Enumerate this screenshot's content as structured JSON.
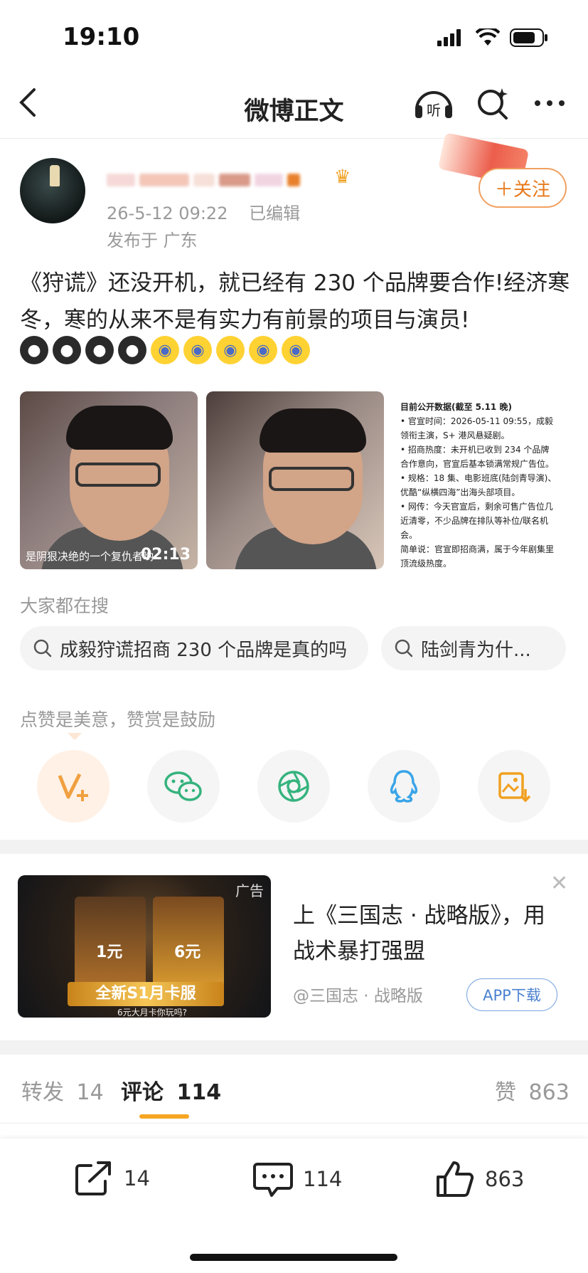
{
  "status_bar": {
    "time": "19:10"
  },
  "nav": {
    "title": "微博正文",
    "listen_label": "听"
  },
  "post": {
    "timestamp": "26-5-12 09:22",
    "edited_label": "已编辑",
    "location": "发布于 广东",
    "follow_label": "＋关注",
    "text": "《狩谎》还没开机，就已经有 230 个品牌要合作!经济寒冬，寒的从来不是有实力有前景的项目与演员!",
    "emojis": [
      "cry",
      "cry",
      "cry",
      "cry",
      "fear",
      "fear",
      "fear",
      "fear",
      "fear"
    ],
    "video": {
      "caption": "是阴狠决绝的一个复仇者哟",
      "duration": "02:13"
    },
    "doc_image": {
      "heading": "目前公开数据(截至 5.11 晚)",
      "lines": [
        "• 官宣时间：2026-05-11 09:55，成毅领衔主演，S+ 港风悬疑剧。",
        "• 招商热度：未开机已收到 234 个品牌合作意向，官宣后基本锁满常规广告位。",
        "• 规格：18 集、电影班底(陆剑青导演)、优酷“纵横四海”出海头部项目。",
        "• 网传：今天官宣后，剩余可售广告位几近清零，不少品牌在排队等补位/联名机会。",
        "简单说：官宣即招商满，属于今年剧集里顶流级热度。"
      ]
    }
  },
  "searches": {
    "label": "大家都在搜",
    "items": [
      "成毅狩谎招商 230 个品牌是真的吗",
      "陆剑青为什..."
    ]
  },
  "reward": {
    "label": "点赞是美意，赞赏是鼓励",
    "share_targets": [
      "v-plus-icon",
      "wechat-icon",
      "moments-icon",
      "qq-icon",
      "save-image-icon"
    ]
  },
  "ad": {
    "tag": "广告",
    "title": "上《三国志 · 战略版》，用战术暴打强盟",
    "source": "@三国志 · 战略版",
    "download_label": "APP下载",
    "banner_text": "全新S1月卡服",
    "banner_sub": "6元大月卡你玩吗?",
    "card1_price": "1元",
    "card2_price": "6元"
  },
  "tabs": {
    "repost_label": "转发",
    "repost_count": "14",
    "comment_label": "评论",
    "comment_count": "114",
    "like_label": "赞",
    "like_count": "863"
  },
  "bottom_bar": {
    "repost_count": "14",
    "comment_count": "114",
    "like_count": "863"
  },
  "colors": {
    "accent_orange": "#f5a623",
    "follow_orange": "#e8781a",
    "link_blue": "#4a80d0"
  }
}
